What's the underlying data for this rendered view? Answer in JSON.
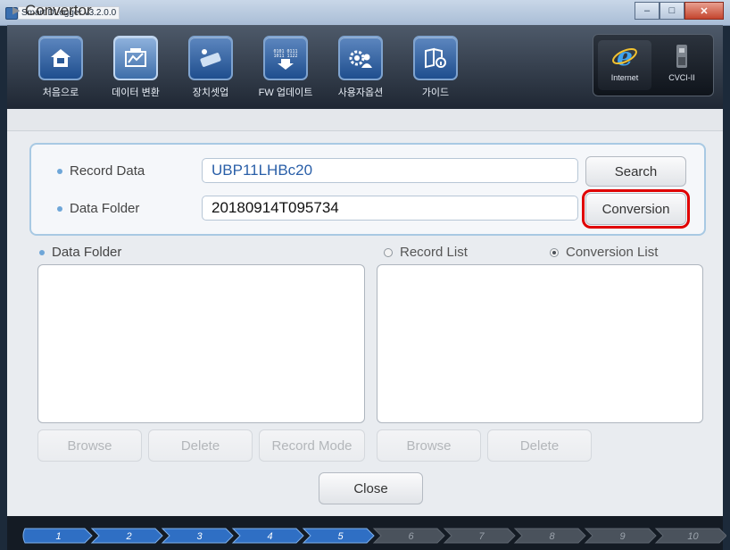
{
  "window": {
    "title": "Smart DLogger v3.2.0.0"
  },
  "toolbar": {
    "tools": [
      {
        "label": "처음으로",
        "icon": "home-icon",
        "active": false
      },
      {
        "label": "데이터 변환",
        "icon": "data-convert-icon",
        "active": true
      },
      {
        "label": "장치셋업",
        "icon": "device-setup-icon",
        "active": false
      },
      {
        "label": "FW 업데이트",
        "icon": "fw-update-icon",
        "active": false
      },
      {
        "label": "사용자옵션",
        "icon": "user-options-icon",
        "active": false
      },
      {
        "label": "가이드",
        "icon": "guide-icon",
        "active": false
      }
    ],
    "right": [
      {
        "label": "Internet",
        "icon": "internet-explorer-icon"
      },
      {
        "label": "CVCI-II",
        "icon": "cvci-device-icon"
      }
    ]
  },
  "section": {
    "title": "Convertor"
  },
  "form": {
    "record_data_label": "Record Data",
    "record_data_value": "UBP11LHBc20",
    "data_folder_label": "Data Folder",
    "data_folder_value": "20180914T095734",
    "search_label": "Search",
    "conversion_label": "Conversion"
  },
  "lists": {
    "data_folder_title": "Data Folder",
    "record_list_label": "Record List",
    "conversion_list_label": "Conversion List",
    "selected": "Conversion List"
  },
  "buttons": {
    "browse_left": "Browse",
    "delete_left": "Delete",
    "record_mode": "Record Mode",
    "browse_right": "Browse",
    "delete_right": "Delete",
    "close": "Close"
  },
  "steps": [
    "1",
    "2",
    "3",
    "4",
    "5",
    "6",
    "7",
    "8",
    "9",
    "10"
  ],
  "steps_active_count": 5,
  "colors": {
    "accent": "#2f6fc4",
    "highlight": "#e00000",
    "input_text": "#2a5fa8"
  }
}
